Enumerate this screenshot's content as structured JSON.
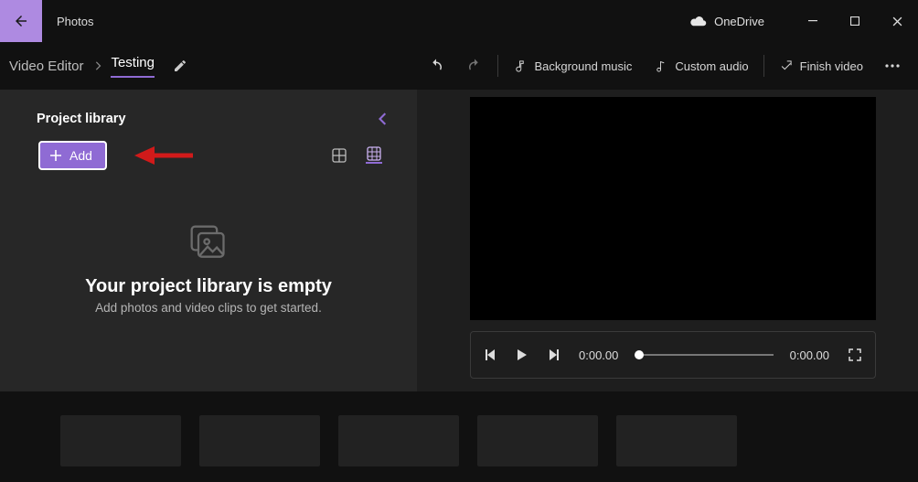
{
  "app": {
    "title": "Photos"
  },
  "titlebar": {
    "onedrive": "OneDrive"
  },
  "breadcrumb": {
    "root": "Video Editor",
    "project": "Testing"
  },
  "toolbar": {
    "bg_music": "Background music",
    "custom_audio": "Custom audio",
    "finish": "Finish video"
  },
  "library": {
    "title": "Project library",
    "add_label": "Add",
    "empty_heading": "Your project library is empty",
    "empty_sub": "Add photos and video clips to get started."
  },
  "transport": {
    "time_start": "0:00.00",
    "time_end": "0:00.00"
  },
  "colors": {
    "accent": "#8f6bd4"
  }
}
